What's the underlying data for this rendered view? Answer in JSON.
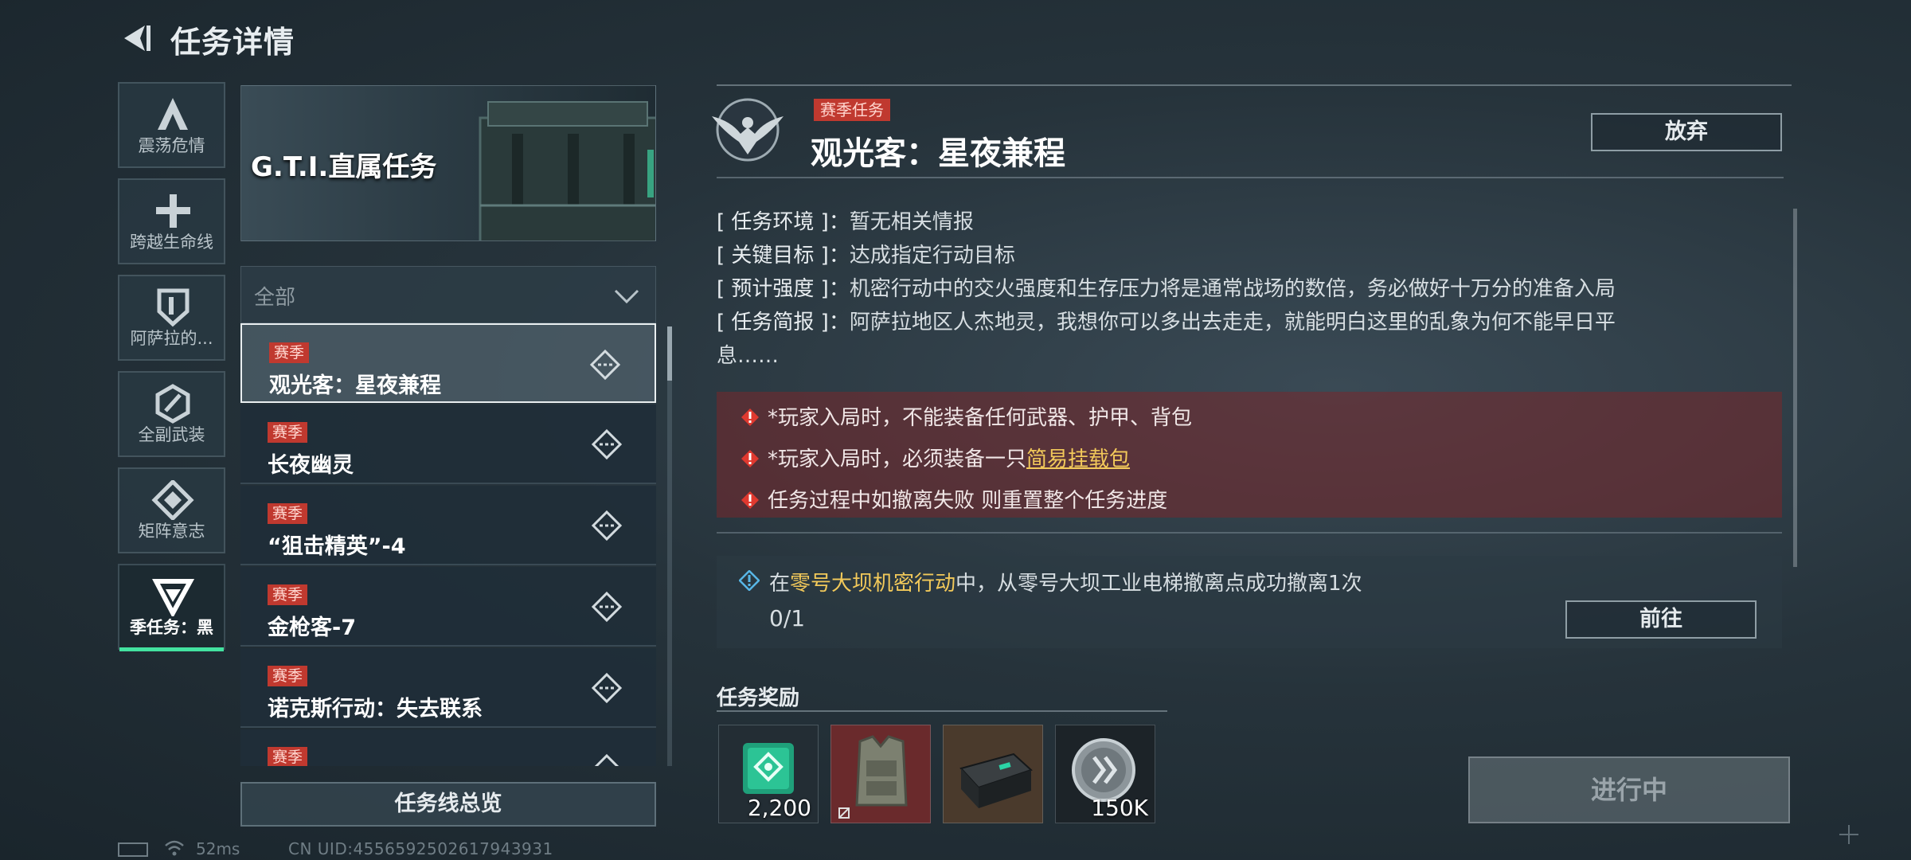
{
  "header": {
    "title": "任务详情"
  },
  "categories": [
    {
      "label": "震荡危情",
      "icon": "triangle-a-icon"
    },
    {
      "label": "跨越生命线",
      "icon": "cross-icon"
    },
    {
      "label": "阿萨拉的...",
      "icon": "shield-icon"
    },
    {
      "label": "全副武装",
      "icon": "hexagon-slash-icon"
    },
    {
      "label": "矩阵意志",
      "icon": "diamond-icon"
    },
    {
      "label": "季任务：黑",
      "icon": "inverted-triangle-icon",
      "active": true
    }
  ],
  "banner": {
    "text": "G.T.I.直属任务"
  },
  "filter": {
    "selected": "全部"
  },
  "missions": [
    {
      "tag": "赛季",
      "name": "观光客：星夜兼程",
      "selected": true
    },
    {
      "tag": "赛季",
      "name": "长夜幽灵"
    },
    {
      "tag": "赛季",
      "name": "“狙击精英”-4"
    },
    {
      "tag": "赛季",
      "name": "金枪客-7"
    },
    {
      "tag": "赛季",
      "name": "诺克斯行动：失去联系"
    },
    {
      "tag": "赛季",
      "name": ""
    }
  ],
  "overview_button": "任务线总览",
  "status_bar": {
    "ping": "52ms",
    "uid": "CN UID:4556592502617943931"
  },
  "detail": {
    "season_tag": "赛季任务",
    "title": "观光客：星夜兼程",
    "abandon_label": "放弃",
    "info": [
      {
        "key": "[ 任务环境 ]：",
        "value": "暂无相关情报"
      },
      {
        "key": "[ 关键目标 ]：",
        "value": "达成指定行动目标"
      },
      {
        "key": "[ 预计强度 ]：",
        "value": "机密行动中的交火强度和生存压力将是通常战场的数倍，务必做好十万分的准备入局"
      },
      {
        "key": "[ 任务简报 ]：",
        "value": "阿萨拉地区人杰地灵，我想你可以多出去走走，就能明白这里的乱象为何不能早日平"
      },
      {
        "key": "",
        "value": "息……"
      }
    ],
    "warnings": [
      {
        "text": "*玩家入局时，不能装备任何武器、护甲、背包",
        "link": ""
      },
      {
        "text": "*玩家入局时，必须装备一只",
        "link": "简易挂载包"
      },
      {
        "text": "任务过程中如撤离失败 则重置整个任务进度",
        "link": ""
      }
    ],
    "objective": {
      "prefix": "在",
      "highlight": "零号大坝机密行动",
      "suffix": "中，从零号大坝工业电梯撤离点成功撤离1次",
      "progress": "0/1",
      "goto_label": "前往"
    },
    "rewards_title": "任务奖励",
    "rewards": [
      {
        "icon": "green-token-icon",
        "count": "2,200"
      },
      {
        "icon": "armor-vest-icon",
        "count": ""
      },
      {
        "icon": "black-case-icon",
        "count": ""
      },
      {
        "icon": "silver-coin-icon",
        "count": "150K"
      }
    ],
    "status_button": "进行中"
  },
  "colors": {
    "accent_green": "#43e2a0",
    "season_red": "#c0392f",
    "highlight_yellow": "#f2c95a"
  }
}
